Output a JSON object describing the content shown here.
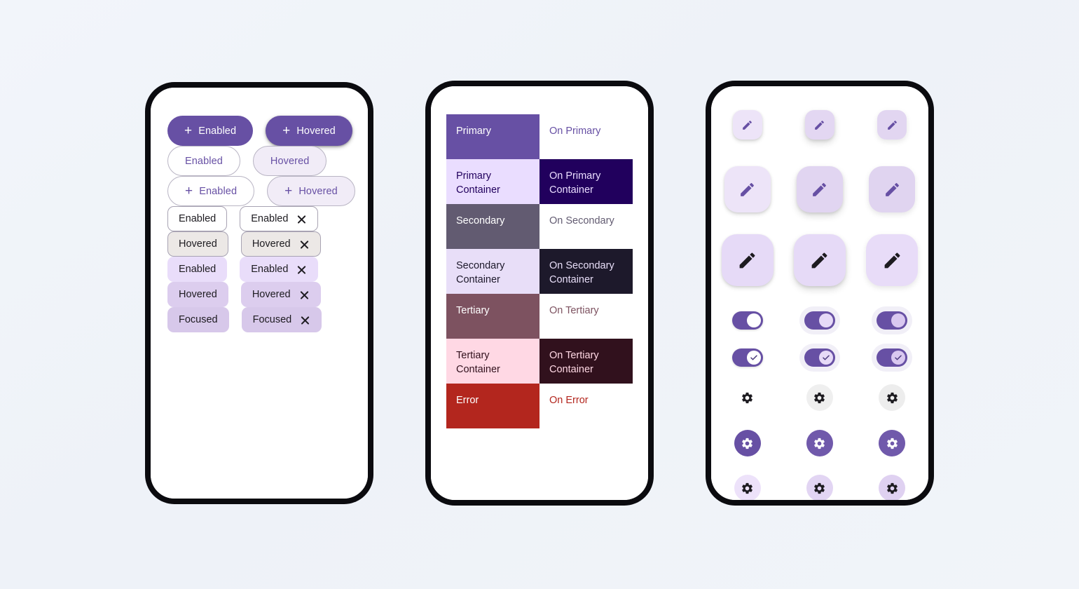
{
  "theme": {
    "background": "#f0f3f8",
    "primary": "#6750A4",
    "on_primary": "#FFFFFF",
    "primary_container": "#EADDFF",
    "on_primary_container": "#21005D",
    "secondary": "#625B71",
    "on_secondary": "#FFFFFF",
    "secondary_container": "#E8DEF8",
    "on_secondary_container": "#1D192B",
    "tertiary": "#7D5260",
    "on_tertiary": "#FFFFFF",
    "tertiary_container": "#FFD8E4",
    "on_tertiary_container": "#31111D",
    "error": "#B3261E",
    "on_error": "#FFFFFF",
    "outline": "#a8a3b3",
    "frame": "#0b0b0f"
  },
  "phone1": {
    "name": "buttons-and-chips-panel",
    "rows": [
      {
        "name": "filled-buttons-row",
        "kind": "filled-button",
        "items": [
          {
            "label": "Enabled",
            "state": "enabled",
            "icon": "plus-icon",
            "has_icon": true
          },
          {
            "label": "Hovered",
            "state": "hovered",
            "icon": "plus-icon",
            "has_icon": true
          }
        ]
      },
      {
        "name": "outlined-buttons-row",
        "kind": "outlined-button",
        "items": [
          {
            "label": "Enabled",
            "state": "enabled",
            "has_icon": false
          },
          {
            "label": "Hovered",
            "state": "hovered",
            "has_icon": false
          }
        ]
      },
      {
        "name": "outlined-icon-buttons-row",
        "kind": "outlined-button",
        "items": [
          {
            "label": "Enabled",
            "state": "enabled",
            "icon": "plus-icon",
            "has_icon": true
          },
          {
            "label": "Hovered",
            "state": "hovered",
            "icon": "plus-icon",
            "has_icon": true
          }
        ]
      },
      {
        "name": "outlined-chips-enabled-row",
        "kind": "outlined-chip",
        "items": [
          {
            "label": "Enabled",
            "state": "enabled",
            "has_close": false
          },
          {
            "label": "Enabled",
            "state": "enabled",
            "has_close": true,
            "close_icon": "close-icon"
          }
        ]
      },
      {
        "name": "outlined-chips-hovered-row",
        "kind": "outlined-chip",
        "items": [
          {
            "label": "Hovered",
            "state": "hovered",
            "has_close": false
          },
          {
            "label": "Hovered",
            "state": "hovered",
            "has_close": true,
            "close_icon": "close-icon"
          }
        ]
      },
      {
        "name": "filled-chips-enabled-row",
        "kind": "filled-chip",
        "items": [
          {
            "label": "Enabled",
            "state": "enabled",
            "has_close": false
          },
          {
            "label": "Enabled",
            "state": "enabled",
            "has_close": true,
            "close_icon": "close-icon"
          }
        ]
      },
      {
        "name": "filled-chips-hovered-row",
        "kind": "filled-chip",
        "items": [
          {
            "label": "Hovered",
            "state": "hovered",
            "has_close": false
          },
          {
            "label": "Hovered",
            "state": "hovered",
            "has_close": true,
            "close_icon": "close-icon"
          }
        ]
      },
      {
        "name": "filled-chips-focused-row",
        "kind": "filled-chip",
        "items": [
          {
            "label": "Focused",
            "state": "focused",
            "has_close": false
          },
          {
            "label": "Focused",
            "state": "focused",
            "has_close": true,
            "close_icon": "close-icon"
          }
        ]
      }
    ]
  },
  "phone2": {
    "name": "color-roles-panel",
    "swatches": [
      {
        "left_label": "Primary",
        "left_bg": "#6750A4",
        "left_fg": "#FFFFFF",
        "right_label": "On Primary",
        "right_bg": "#FFFFFF",
        "right_fg": "#6750A4",
        "height": "tall"
      },
      {
        "left_label": "Primary Container",
        "left_bg": "#EADDFF",
        "left_fg": "#21005D",
        "right_label": "On Primary Container",
        "right_bg": "#21005D",
        "right_fg": "#EADDFF",
        "height": "tall"
      },
      {
        "left_label": "Secondary",
        "left_bg": "#625B71",
        "left_fg": "#FFFFFF",
        "right_label": "On Secondary",
        "right_bg": "#FFFFFF",
        "right_fg": "#625B71",
        "height": "tall"
      },
      {
        "left_label": "Secondary Container",
        "left_bg": "#E8DEF8",
        "left_fg": "#1D192B",
        "right_label": "On Secondary Container",
        "right_bg": "#1D192B",
        "right_fg": "#E8DEF8",
        "height": "tall"
      },
      {
        "left_label": "Tertiary",
        "left_bg": "#7D5260",
        "left_fg": "#FFFFFF",
        "right_label": "On Tertiary",
        "right_bg": "#FFFFFF",
        "right_fg": "#7D5260",
        "height": "tall"
      },
      {
        "left_label": "Tertiary Container",
        "left_bg": "#FFD8E4",
        "left_fg": "#31111D",
        "right_label": "On Tertiary Container",
        "right_bg": "#31111D",
        "right_fg": "#FFD8E4",
        "height": "tall"
      },
      {
        "left_label": "Error",
        "left_bg": "#B3261E",
        "left_fg": "#FFFFFF",
        "right_label": "On Error",
        "right_bg": "#FFFFFF",
        "right_fg": "#B3261E",
        "height": "tall"
      }
    ]
  },
  "phone3": {
    "name": "fabs-switches-icon-buttons-panel",
    "fab_rows": [
      {
        "name": "small-fab-row",
        "size": "sm",
        "items": [
          {
            "icon": "edit-pencil-icon",
            "bg": "#EDE4F8",
            "fg": "#6750A4",
            "shadow": "fab-sh-1"
          },
          {
            "icon": "edit-pencil-icon",
            "bg": "#E3D7F2",
            "fg": "#6750A4",
            "shadow": "fab-sh-2"
          },
          {
            "icon": "edit-pencil-icon",
            "bg": "#E2D6F1",
            "fg": "#6750A4",
            "shadow": "fab-sh-3"
          }
        ]
      },
      {
        "name": "medium-fab-row",
        "size": "md",
        "items": [
          {
            "icon": "edit-pencil-icon",
            "bg": "#EDE4F8",
            "fg": "#6750A4",
            "shadow": "fab-sh-1"
          },
          {
            "icon": "edit-pencil-icon",
            "bg": "#E1D5F1",
            "fg": "#6750A4",
            "shadow": "fab-sh-2"
          },
          {
            "icon": "edit-pencil-icon",
            "bg": "#E0D4F0",
            "fg": "#6750A4",
            "shadow": "fab-sh-3"
          }
        ]
      },
      {
        "name": "large-fab-row",
        "size": "lg",
        "items": [
          {
            "icon": "edit-pencil-icon",
            "bg": "#E6DAF7",
            "fg": "#1D1B20",
            "shadow": "fab-sh-1"
          },
          {
            "icon": "edit-pencil-icon",
            "bg": "#E6DAF7",
            "fg": "#1D1B20",
            "shadow": "fab-sh-2"
          },
          {
            "icon": "edit-pencil-icon",
            "bg": "#E8DCF8",
            "fg": "#1D1B20",
            "shadow": "fab-sh-3"
          }
        ]
      }
    ],
    "switch_rows": [
      {
        "name": "switch-row-plain",
        "items": [
          {
            "state": "on",
            "track": "#6750A4",
            "thumb": "#FFFFFF",
            "has_check": false,
            "halo": "sh1"
          },
          {
            "state": "on",
            "track": "#6750A4",
            "thumb": "#E6DAF7",
            "has_check": false,
            "halo": "sh2"
          },
          {
            "state": "on",
            "track": "#6750A4",
            "thumb": "#D9C8F0",
            "has_check": false,
            "halo": "sh2"
          }
        ]
      },
      {
        "name": "switch-row-checked",
        "items": [
          {
            "state": "on",
            "track": "#6750A4",
            "thumb": "#FFFFFF",
            "has_check": true,
            "check_icon": "check-icon",
            "halo": "sh1"
          },
          {
            "state": "on",
            "track": "#6750A4",
            "thumb": "#E6DAF7",
            "has_check": true,
            "check_icon": "check-icon",
            "halo": "sh2"
          },
          {
            "state": "on",
            "track": "#6750A4",
            "thumb": "#D9C8F0",
            "has_check": true,
            "check_icon": "check-icon",
            "halo": "sh2"
          }
        ]
      }
    ],
    "icon_button_rows": [
      {
        "name": "standard-icon-button-row",
        "items": [
          {
            "icon": "gear-icon",
            "bg": "transparent",
            "fg": "#1D1B20"
          },
          {
            "icon": "gear-icon",
            "bg": "#EFEFEF",
            "fg": "#1D1B20"
          },
          {
            "icon": "gear-icon",
            "bg": "#EDEDED",
            "fg": "#1D1B20"
          }
        ]
      },
      {
        "name": "filled-icon-button-row",
        "items": [
          {
            "icon": "gear-icon",
            "bg": "#6750A4",
            "fg": "#FFFFFF"
          },
          {
            "icon": "gear-icon",
            "bg": "#7059AB",
            "fg": "#FFFFFF"
          },
          {
            "icon": "gear-icon",
            "bg": "#7059AB",
            "fg": "#FFFFFF"
          }
        ]
      },
      {
        "name": "tonal-icon-button-row",
        "items": [
          {
            "icon": "gear-icon",
            "bg": "#EDE2FA",
            "fg": "#1D1B20"
          },
          {
            "icon": "gear-icon",
            "bg": "#E2D5F3",
            "fg": "#1D1B20"
          },
          {
            "icon": "gear-icon",
            "bg": "#DFD1F1",
            "fg": "#1D1B20"
          }
        ]
      }
    ]
  }
}
